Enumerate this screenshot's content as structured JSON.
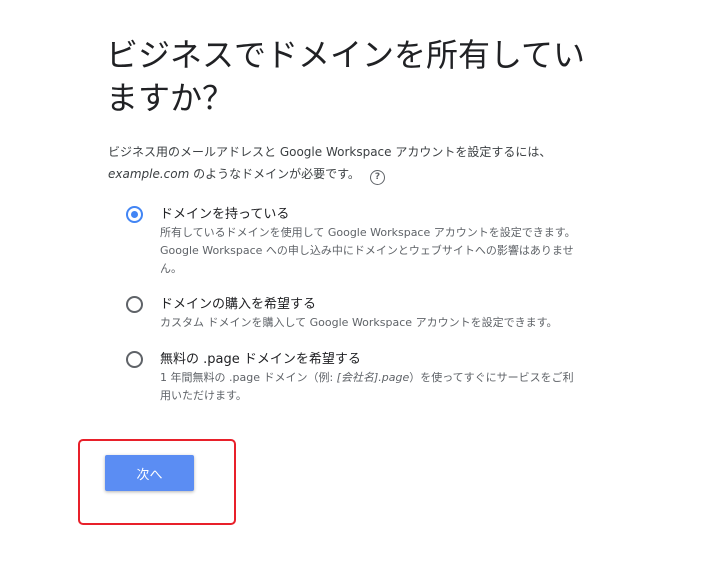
{
  "page": {
    "title": "ビジネスでドメインを所有していますか？",
    "description_line1": "ビジネス用のメールアドレスと Google Workspace アカウントを設定するには、",
    "description_example": "example.com",
    "description_line2_rest": " のようなドメインが必要です。",
    "help_icon": "help-circle-icon",
    "help_glyph": "?"
  },
  "options": [
    {
      "label": "ドメインを持っている",
      "description": "所有しているドメインを使用して Google Workspace アカウントを設定できます。Google Workspace への申し込み中にドメインとウェブサイトへの影響はありません。",
      "selected": true
    },
    {
      "label": "ドメインの購入を希望する",
      "description": "カスタム ドメインを購入して Google Workspace アカウントを設定できます。",
      "selected": false
    },
    {
      "label": "無料の .page ドメインを希望する",
      "description_prefix": "1 年間無料の .page ドメイン（例: ",
      "description_example": "[会社名].page",
      "description_suffix": "）を使ってすぐにサービスをご利用いただけます。",
      "selected": false
    }
  ],
  "actions": {
    "next_label": "次へ"
  },
  "colors": {
    "accent": "#4285f4",
    "button": "#5b8df3",
    "highlight": "#e8202a"
  }
}
